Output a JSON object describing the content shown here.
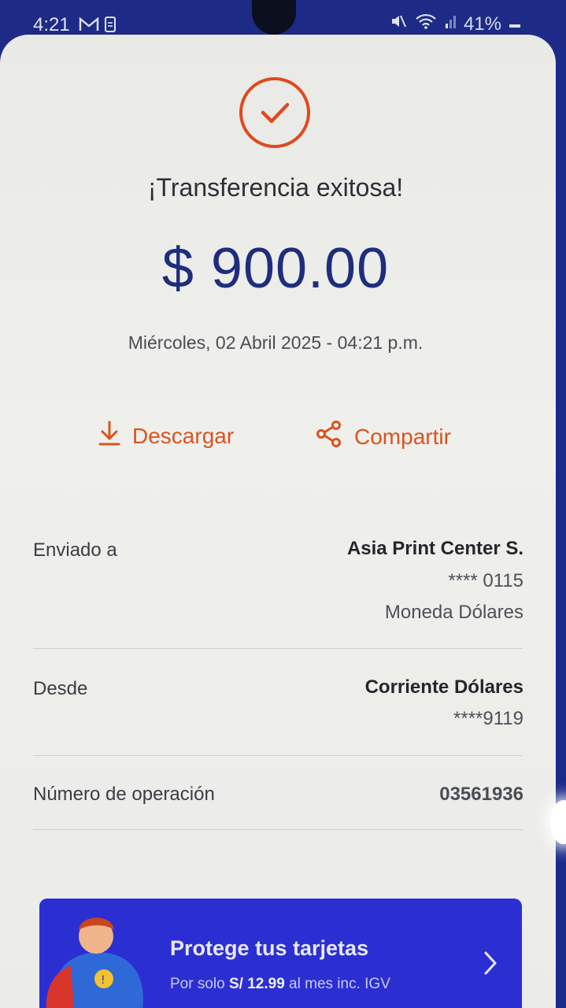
{
  "status_bar": {
    "time": "4:21",
    "battery": "41%",
    "icons": [
      "gmail-icon",
      "sim-icon",
      "mute-icon",
      "wifi-icon",
      "signal-icon",
      "battery-icon"
    ]
  },
  "receipt": {
    "title": "¡Transferencia exitosa!",
    "amount": "$ 900.00",
    "datetime": "Miércoles, 02 Abril 2025 - 04:21 p.m.",
    "actions": {
      "download_label": "Descargar",
      "share_label": "Compartir"
    },
    "details": {
      "sent_to_label": "Enviado a",
      "sent_to_name": "Asia Print Center S.",
      "sent_to_account": "**** 0115",
      "sent_to_currency": "Moneda Dólares",
      "from_label": "Desde",
      "from_account_name": "Corriente Dólares",
      "from_account_number": "****9119",
      "operation_label": "Número de operación",
      "operation_number": "03561936"
    }
  },
  "promo": {
    "title": "Protege tus tarjetas",
    "subtitle_prefix": "Por solo",
    "subtitle_price": "S/ 12.99",
    "subtitle_suffix": "al mes inc. IGV"
  },
  "colors": {
    "accent_orange": "#df4a1e",
    "amount_blue": "#1e2d7d",
    "promo_blue": "#2b2fd2",
    "status_bar": "#1d2b86"
  }
}
